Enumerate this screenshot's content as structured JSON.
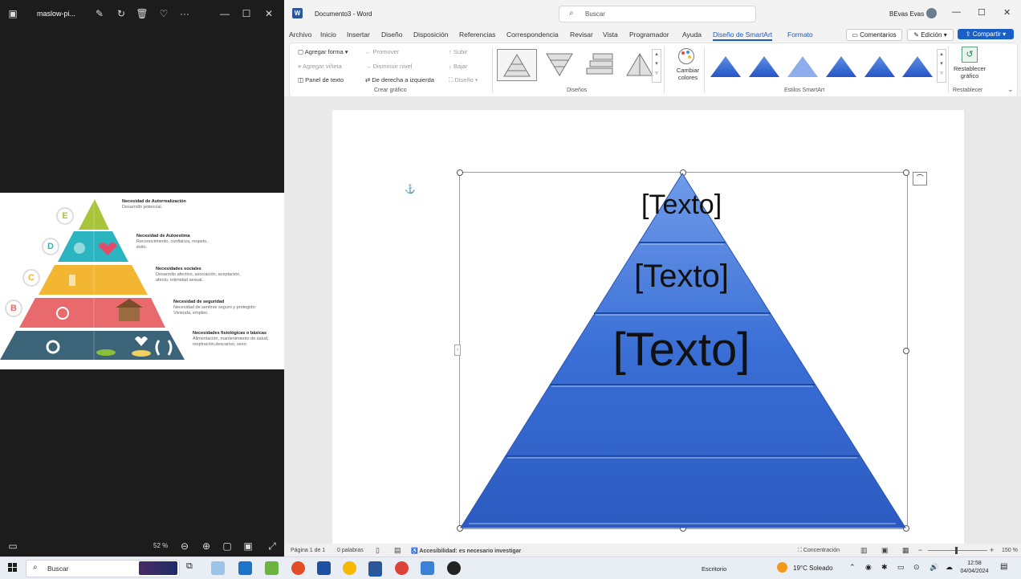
{
  "viewer": {
    "file_name": "maslow-pi...",
    "zoom": "52 %",
    "pyramid": [
      {
        "letter": "E",
        "title": "Necesidad de Autorrealización",
        "desc": "Desarrollo potencial.",
        "color": "#a8c438"
      },
      {
        "letter": "D",
        "title": "Necesidad de Autoestima",
        "desc": "Reconocimiento, confianza, respeto, éxito.",
        "color": "#2bb5c0"
      },
      {
        "letter": "C",
        "title": "Necesidades sociales",
        "desc": "Desarrollo afectivo, asociación, aceptación, afecto, intimidad sexual.",
        "color": "#f2b632"
      },
      {
        "letter": "B",
        "title": "Necesidad de seguridad",
        "desc": "Necesidad de sentirse seguro y protegido: Vivienda, empleo.",
        "color": "#e96a6c"
      },
      {
        "letter": "",
        "title": "Necesidades fisiológicas o básicas",
        "desc": "Alimentación, mantenimiento de salud, respiración,descanso, sexo.",
        "color": "#3b6478"
      }
    ]
  },
  "word": {
    "doc_title": "Documento3 - Word",
    "search_placeholder": "Buscar",
    "user": "BEvas Evas",
    "tabs": [
      "Archivo",
      "Inicio",
      "Insertar",
      "Diseño",
      "Disposición",
      "Referencias",
      "Correspondencia",
      "Revisar",
      "Vista",
      "Programador",
      "Ayuda",
      "Diseño de SmartArt",
      "Formato"
    ],
    "active_tab": "Diseño de SmartArt",
    "comments_button": "Comentarios",
    "editing_button": "Edición",
    "share_button": "Compartir",
    "ribbon": {
      "add_shape": "Agregar forma",
      "add_bullet": "Agregar viñeta",
      "text_pane": "Panel de texto",
      "promote": "Promover",
      "demote": "Disminuir nivel",
      "rtl": "De derecha a izquierda",
      "up": "Subir",
      "down": "Bajar",
      "layout": "Diseño",
      "group_create": "Crear gráfico",
      "group_layouts": "Diseños",
      "change_colors_1": "Cambiar",
      "change_colors_2": "colores",
      "group_styles": "Estilos SmartArt",
      "reset_1": "Restablecer",
      "reset_2": "gráfico",
      "group_reset": "Restablecer"
    },
    "smartart_texts": [
      "[Texto]",
      "[Texto]",
      "[Texto]"
    ],
    "status": {
      "page": "Página 1 de 1",
      "words": "0 palabras",
      "accessibility": "Accesibilidad: es necesario investigar",
      "focus": "Concentración",
      "zoom": "150 %"
    }
  },
  "taskbar": {
    "search": "Buscar",
    "desktop": "Escritorio",
    "weather": "19°C  Soleado",
    "time": "12:58",
    "date": "04/04/2024"
  }
}
